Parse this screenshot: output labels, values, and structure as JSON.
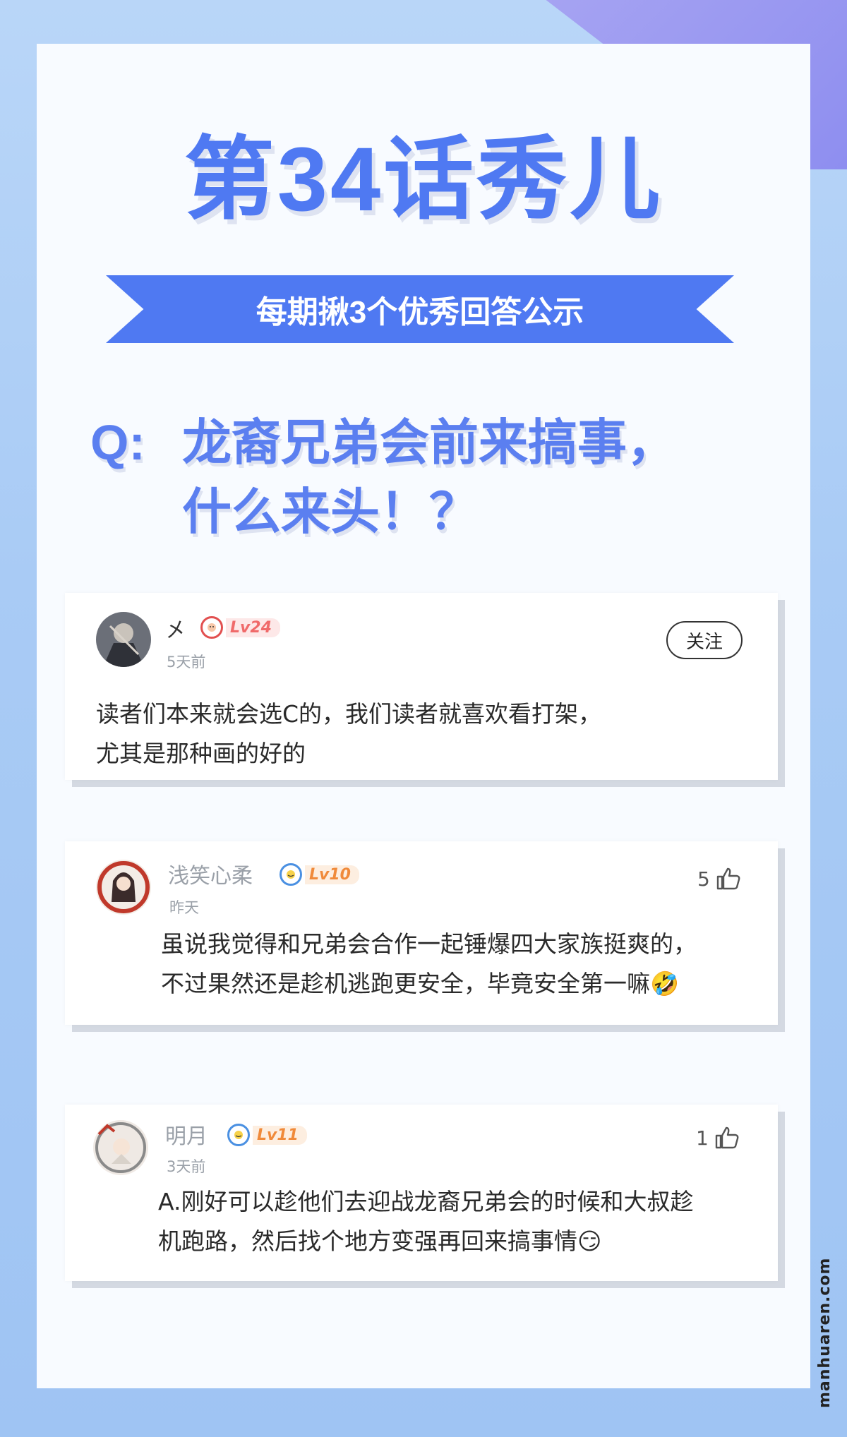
{
  "header": {
    "title": "第34话秀儿",
    "ribbon": "每期揪3个优秀回答公示",
    "question_prefix": "Q:",
    "question_line1": "龙裔兄弟会前来搞事，",
    "question_line2": "什么来头！？"
  },
  "comments": [
    {
      "username": "㐅",
      "level": "Lv24",
      "time": "5天前",
      "action": "关注",
      "text_line1": "读者们本来就会选C的，我们读者就喜欢看打架，",
      "text_line2": "尤其是那种画的好的"
    },
    {
      "username": "浅笑心柔",
      "level": "Lv10",
      "time": "昨天",
      "likes": "5",
      "text_line1": "虽说我觉得和兄弟会合作一起锤爆四大家族挺爽的，",
      "text_line2": "不过果然还是趁机逃跑更安全，毕竟安全第一嘛🤣"
    },
    {
      "username": "明月",
      "level": "Lv11",
      "time": "3天前",
      "likes": "1",
      "text_line1": "A.刚好可以趁他们去迎战龙裔兄弟会的时候和大叔趁",
      "text_line2": "机跑路，然后找个地方变强再回来搞事情😏"
    }
  ],
  "watermark": "manhuaren.com",
  "colors": {
    "accent_blue": "#4f79f2",
    "level_red": "#f06a6a",
    "level_orange": "#f08a3a"
  }
}
